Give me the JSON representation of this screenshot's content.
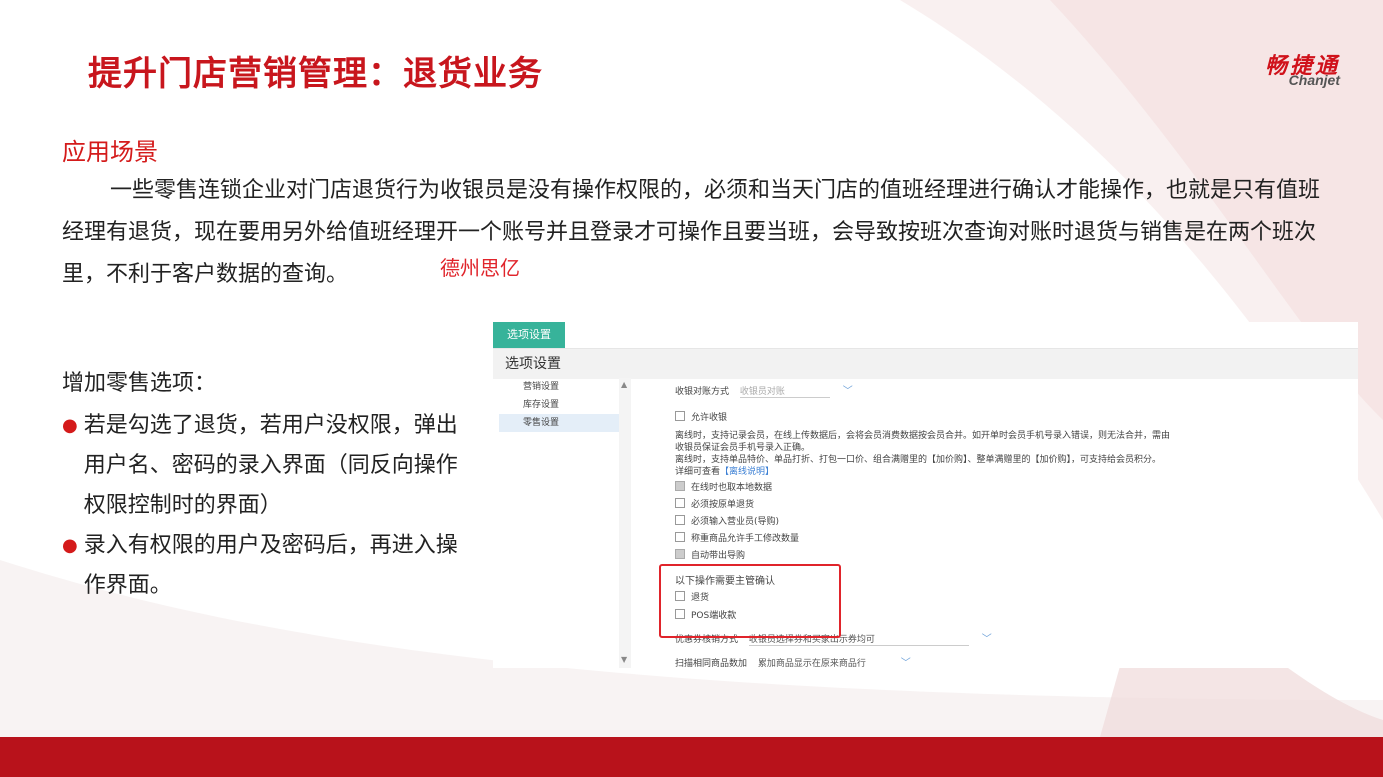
{
  "slide": {
    "title": "提升门店营销管理：退货业务",
    "brand_cn": "畅捷通",
    "brand_en": "Chanjet",
    "section_heading": "应用场景",
    "paragraph": "一些零售连锁企业对门店退货行为收银员是没有操作权限的，必须和当天门店的值班经理进行确认才能操作，也就是只有值班经理有退货，现在要用另外给值班经理开一个账号并且登录才可操作且要当班，会导致按班次查询对账时退货与销售是在两个班次里，不利于客户数据的查询。",
    "watermark": "德州思亿",
    "list_intro": "增加零售选项：",
    "bullets": [
      "若是勾选了退货，若用户没权限，弹出用户名、密码的录入界面（同反向操作权限控制时的界面）",
      "录入有权限的用户及密码后，再进入操作界面。"
    ],
    "bullet_glyph": "●",
    "colors": {
      "accent": "#c8161d",
      "tab_green": "#37b39a",
      "highlight": "#e0242b"
    }
  },
  "screenshot": {
    "tab_label": "选项设置",
    "page_title": "选项设置",
    "scroll_up": "▲",
    "scroll_down": "▼",
    "nav": [
      "营销设置",
      "库存设置",
      "零售设置"
    ],
    "row_reconcile_label": "收银对账方式",
    "row_reconcile_value": "收银员对账",
    "chevron": "﹀",
    "cb_force_label": "允许收银",
    "desc1": "离线时，支持记录会员，在线上传数据后，会将会员消费数据按会员合并。如开单时会员手机号录入错误，则无法合并，需由",
    "desc2": "收银员保证会员手机号录入正确。",
    "desc3": "离线时，支持单品特价、单品打折、打包一口价、组合满赠里的【加价购】、整单满赠里的【加价购】，可支持给会员积分。",
    "desc4_prefix": "详细可查看",
    "desc4_link": "【离线说明】",
    "checks": [
      "在线时也取本地数据",
      "必须按原单退货",
      "必须输入营业员(导购)",
      "称重商品允许手工修改数量",
      "自动带出导购"
    ],
    "confirm_title": "以下操作需要主管确认",
    "confirm_items": [
      "退货",
      "POS端收款"
    ],
    "coupon_label": "优惠券核销方式",
    "coupon_value": "收银员选择券和买家出示券均可",
    "scan_label": "扫描相同商品数加",
    "scan_value": "累加商品显示在原来商品行"
  }
}
